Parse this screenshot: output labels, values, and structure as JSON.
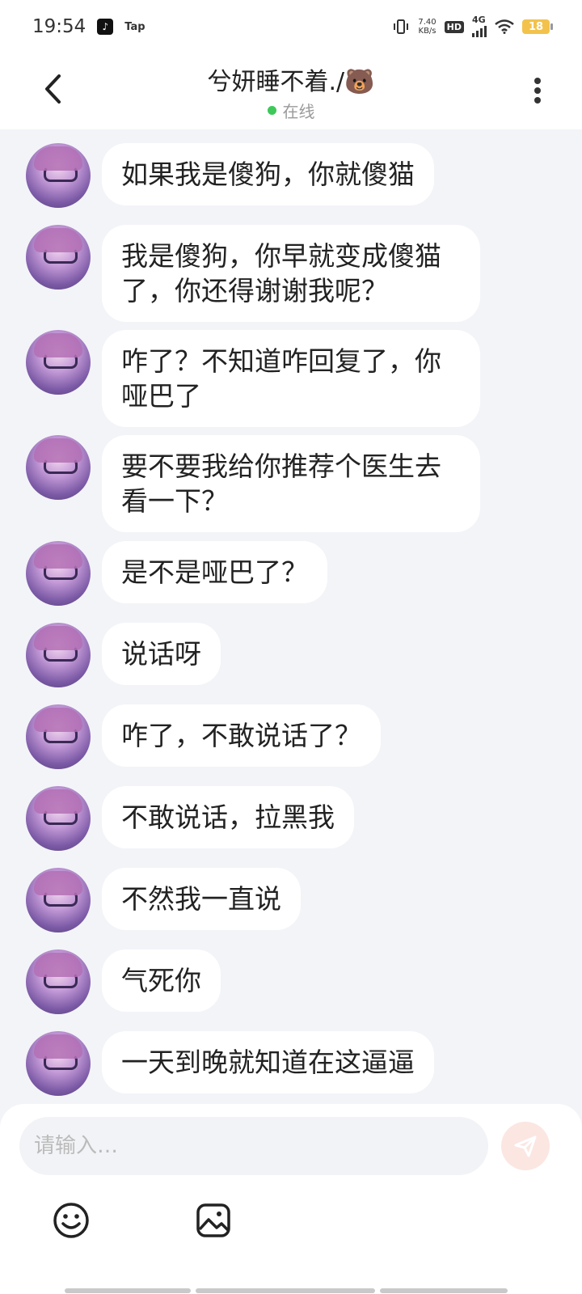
{
  "status_bar": {
    "time": "19:54",
    "tap_label": "Tap",
    "net_speed_value": "7.40",
    "net_speed_unit": "KB/s",
    "hd": "HD",
    "network": "4G",
    "battery": "18"
  },
  "header": {
    "title": "兮妍睡不着./🐻",
    "status": "在线"
  },
  "messages": [
    {
      "text": "如果我是傻狗，你就傻猫"
    },
    {
      "text": "我是傻狗，你早就变成傻猫了，你还得谢谢我呢？"
    },
    {
      "text": "咋了？不知道咋回复了，你哑巴了"
    },
    {
      "text": "要不要我给你推荐个医生去看一下？"
    },
    {
      "text": "是不是哑巴了？"
    },
    {
      "text": "说话呀"
    },
    {
      "text": "咋了，不敢说话了？"
    },
    {
      "text": "不敢说话，拉黑我"
    },
    {
      "text": "不然我一直说"
    },
    {
      "text": "气死你"
    },
    {
      "text": "一天到晚就知道在这逼逼"
    }
  ],
  "composer": {
    "placeholder": "请输入…"
  },
  "icons": {
    "back": "back-arrow-icon",
    "more": "more-vertical-icon",
    "send": "send-icon",
    "emoji": "emoji-icon",
    "image": "image-icon"
  },
  "colors": {
    "background": "#f3f4f8",
    "bubble": "#ffffff",
    "online": "#3ec85a",
    "send_button": "#fbe6e2",
    "battery": "#f3c24c"
  }
}
